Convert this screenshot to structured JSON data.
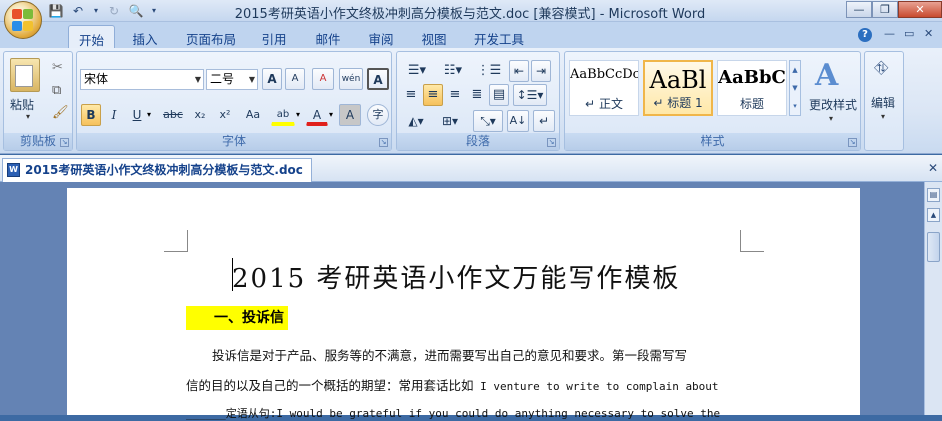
{
  "window": {
    "title": "2015考研英语小作文终极冲刺高分模板与范文.doc [兼容模式] - Microsoft Word",
    "controls": {
      "minimize": "—",
      "restore": "❐",
      "close": "✕"
    }
  },
  "ribbon_tabs": [
    "开始",
    "插入",
    "页面布局",
    "引用",
    "邮件",
    "审阅",
    "视图",
    "开发工具"
  ],
  "ribbon_right": {
    "help": "?",
    "minimize": "—",
    "restore": "▭",
    "close": "✕"
  },
  "clipboard": {
    "paste_label": "粘贴",
    "group_label": "剪贴板"
  },
  "font": {
    "name": "宋体",
    "size": "二号",
    "group_label": "字体",
    "bold": "B",
    "italic": "I",
    "underline": "U",
    "strike": "abc",
    "subscript": "x₂",
    "superscript": "x²",
    "change_case": "Aa",
    "grow": "A",
    "shrink": "A",
    "clear": "A",
    "phonetic": "wén",
    "border": "A",
    "highlight": "ab",
    "color": "A",
    "shade": "A",
    "enclose": "字"
  },
  "paragraph": {
    "group_label": "段落"
  },
  "styles": {
    "group_label": "样式",
    "items": [
      {
        "preview": "AaBbCcDc",
        "name": "正文",
        "marker": "↵"
      },
      {
        "preview": "AaBl",
        "name": "标题 1",
        "marker": "↵"
      },
      {
        "preview": "AaBbC",
        "name": "标题",
        "marker": ""
      }
    ],
    "change_styles": "更改样式"
  },
  "editing": {
    "label": "编辑"
  },
  "colors": {
    "highlight": "#ffff00",
    "font_color": "#e0201c",
    "accent": "#15428b"
  },
  "document_tab": {
    "label": "2015考研英语小作文终极冲刺高分模板与范文.doc",
    "close": "✕"
  },
  "document": {
    "title": "2015 考研英语小作文万能写作模板",
    "heading1": "一、投诉信",
    "para1_line1": "投诉信是对于产品、服务等的不满意，进而需要写出自己的意见和要求。第一段需写写",
    "para1_line2_cn": "信的目的以及自己的一个概括的期望：常用套话比如",
    "para1_line2_en": " I venture to write to complain about",
    "para1_line3": "______定语从句:I would be grateful if you could do anything necessary to solve the"
  }
}
